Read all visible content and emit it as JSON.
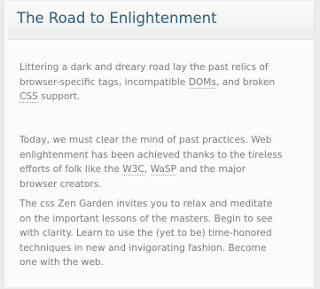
{
  "title": "The Road to Enlightenment",
  "paragraphs": [
    {
      "lines": [
        {
          "before": "Littering a dark and dreary road lay the past relics of",
          "abbr": "",
          "after": ""
        },
        {
          "before": "browser-specific tags, incompatible ",
          "abbr": "DOMs",
          "after": ", and broken"
        },
        {
          "before": "",
          "abbr": "CSS",
          "after": " support."
        }
      ]
    },
    {
      "lines": [
        {
          "before": "Today, we must clear the mind of past practices. Web",
          "abbr": "",
          "after": ""
        },
        {
          "before": "enlightenment has been achieved thanks to the tireless",
          "abbr": "",
          "after": ""
        },
        {
          "before": "efforts of folk like the ",
          "abbr": "W3C",
          "after": ", ",
          "abbr2": "WaSP",
          "after2": " and the major"
        },
        {
          "before": "browser creators.",
          "abbr": "",
          "after": ""
        }
      ]
    },
    {
      "lines": [
        {
          "before": "The css Zen Garden invites you to relax and meditate",
          "abbr": "",
          "after": ""
        },
        {
          "before": "on the important lessons of the masters. Begin to see",
          "abbr": "",
          "after": ""
        },
        {
          "before": "with clarity. Learn to use the (yet to be) time-honored",
          "abbr": "",
          "after": ""
        },
        {
          "before": "techniques in new and invigorating fashion. Become",
          "abbr": "",
          "after": ""
        },
        {
          "before": "one with the web.",
          "abbr": "",
          "after": ""
        }
      ]
    }
  ],
  "colors": {
    "title": "#2a5d7c",
    "body_text": "#7b7b7b",
    "background": "#fbfbfa",
    "abbr_underline": "#8aa2b4"
  }
}
